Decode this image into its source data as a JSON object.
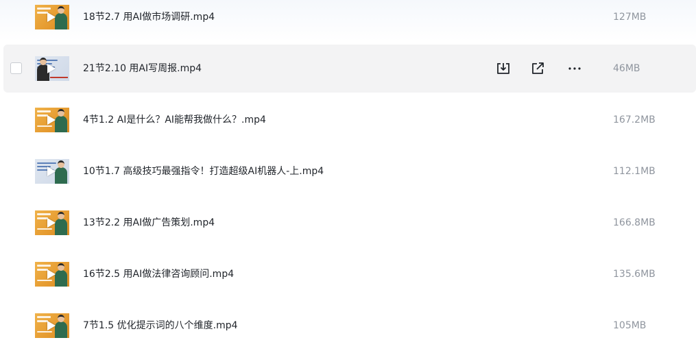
{
  "files": [
    {
      "name": "18节2.7 用AI做市场调研.mp4",
      "size": "127MB",
      "thumb": "orange",
      "hovered": false
    },
    {
      "name": "21节2.10 用AI写周报.mp4",
      "size": "46MB",
      "thumb": "screen",
      "hovered": true
    },
    {
      "name": "4节1.2 AI是什么？AI能帮我做什么？.mp4",
      "size": "167.2MB",
      "thumb": "orange",
      "hovered": false
    },
    {
      "name": "10节1.7 高级技巧最强指令！打造超级AI机器人-上.mp4",
      "size": "112.1MB",
      "thumb": "screen",
      "hovered": false
    },
    {
      "name": "13节2.2 用AI做广告策划.mp4",
      "size": "166.8MB",
      "thumb": "orange",
      "hovered": false
    },
    {
      "name": "16节2.5 用AI做法律咨询顾问.mp4",
      "size": "135.6MB",
      "thumb": "orange",
      "hovered": false
    },
    {
      "name": "7节1.5 优化提示词的八个维度.mp4",
      "size": "105MB",
      "thumb": "orange",
      "hovered": false
    }
  ],
  "row_actions": {
    "download_icon": "download-icon",
    "share_icon": "share-icon",
    "more_icon": "more-icon"
  }
}
